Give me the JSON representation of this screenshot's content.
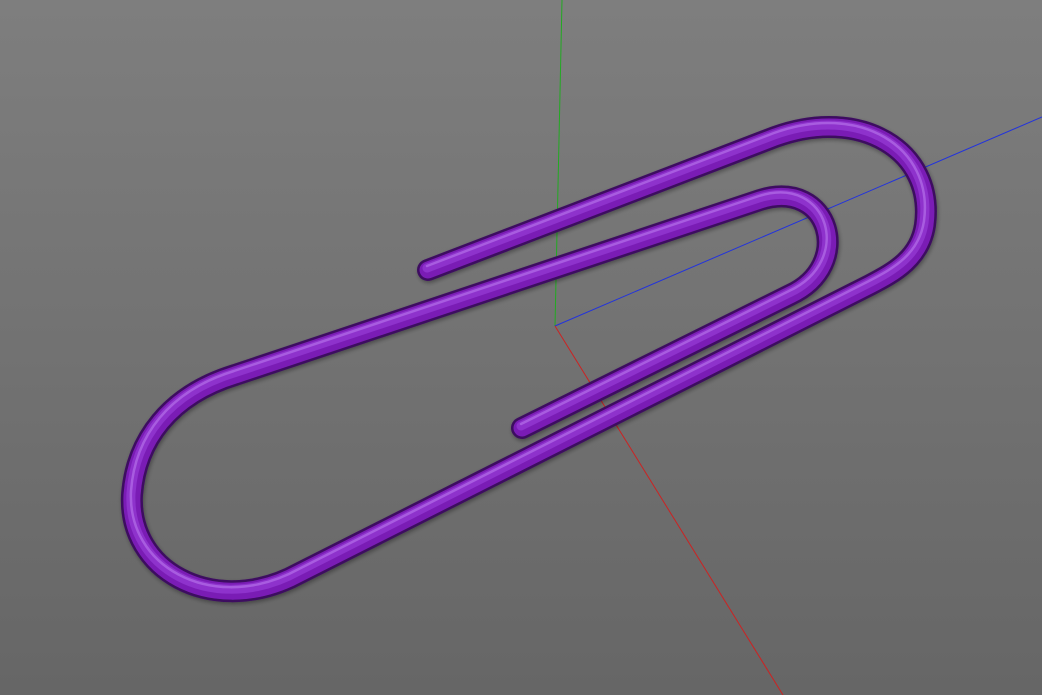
{
  "viewport": {
    "object": "paperclip",
    "object_color": "#7a1fb5",
    "background_color_top": "#7e7e7e",
    "background_color_bottom": "#666666",
    "axes": {
      "x_color": "#cc2222",
      "y_color": "#22aa22",
      "z_color": "#2233dd"
    }
  }
}
